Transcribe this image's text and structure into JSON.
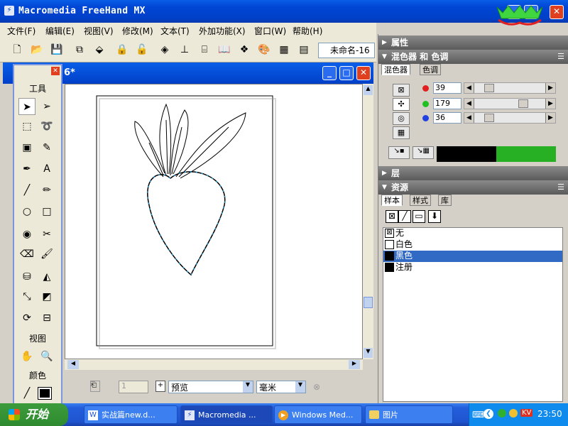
{
  "window": {
    "title": "Macromedia FreeHand MX"
  },
  "menubar": {
    "items": [
      "文件(F)",
      "编辑(E)",
      "视图(V)",
      "修改(M)",
      "文本(T)",
      "外加功能(X)",
      "窗口(W)",
      "帮助(H)"
    ]
  },
  "toolbar": {
    "doc_name": "未命名-16"
  },
  "document": {
    "title_suffix": "6*"
  },
  "tools": {
    "section_tools": "工具",
    "section_view": "视图",
    "section_color": "颜色"
  },
  "panels": {
    "properties": "属性",
    "mixer": "混色器 和 色调",
    "mixer_tabs": [
      "混色器",
      "色调"
    ],
    "layers": "层",
    "assets": "资源",
    "asset_tabs": [
      "样本",
      "样式",
      "库"
    ]
  },
  "color_mixer": {
    "r": "39",
    "g": "179",
    "b": "36"
  },
  "swatches": [
    "无",
    "白色",
    "黑色",
    "注册"
  ],
  "statusbar": {
    "page": "1",
    "preview": "预览",
    "unit": "毫米"
  },
  "taskbar": {
    "start": "开始",
    "tasks": [
      "实战篇new.d...",
      "Macromedia ...",
      "Windows Med...",
      "图片"
    ],
    "clock": "23:50"
  },
  "colors": {
    "accent_blue": "#0040c8",
    "selection": "#316ac5",
    "path": "#1e9bd8",
    "green": "#27b024",
    "start_green": "#2f8a2f"
  }
}
